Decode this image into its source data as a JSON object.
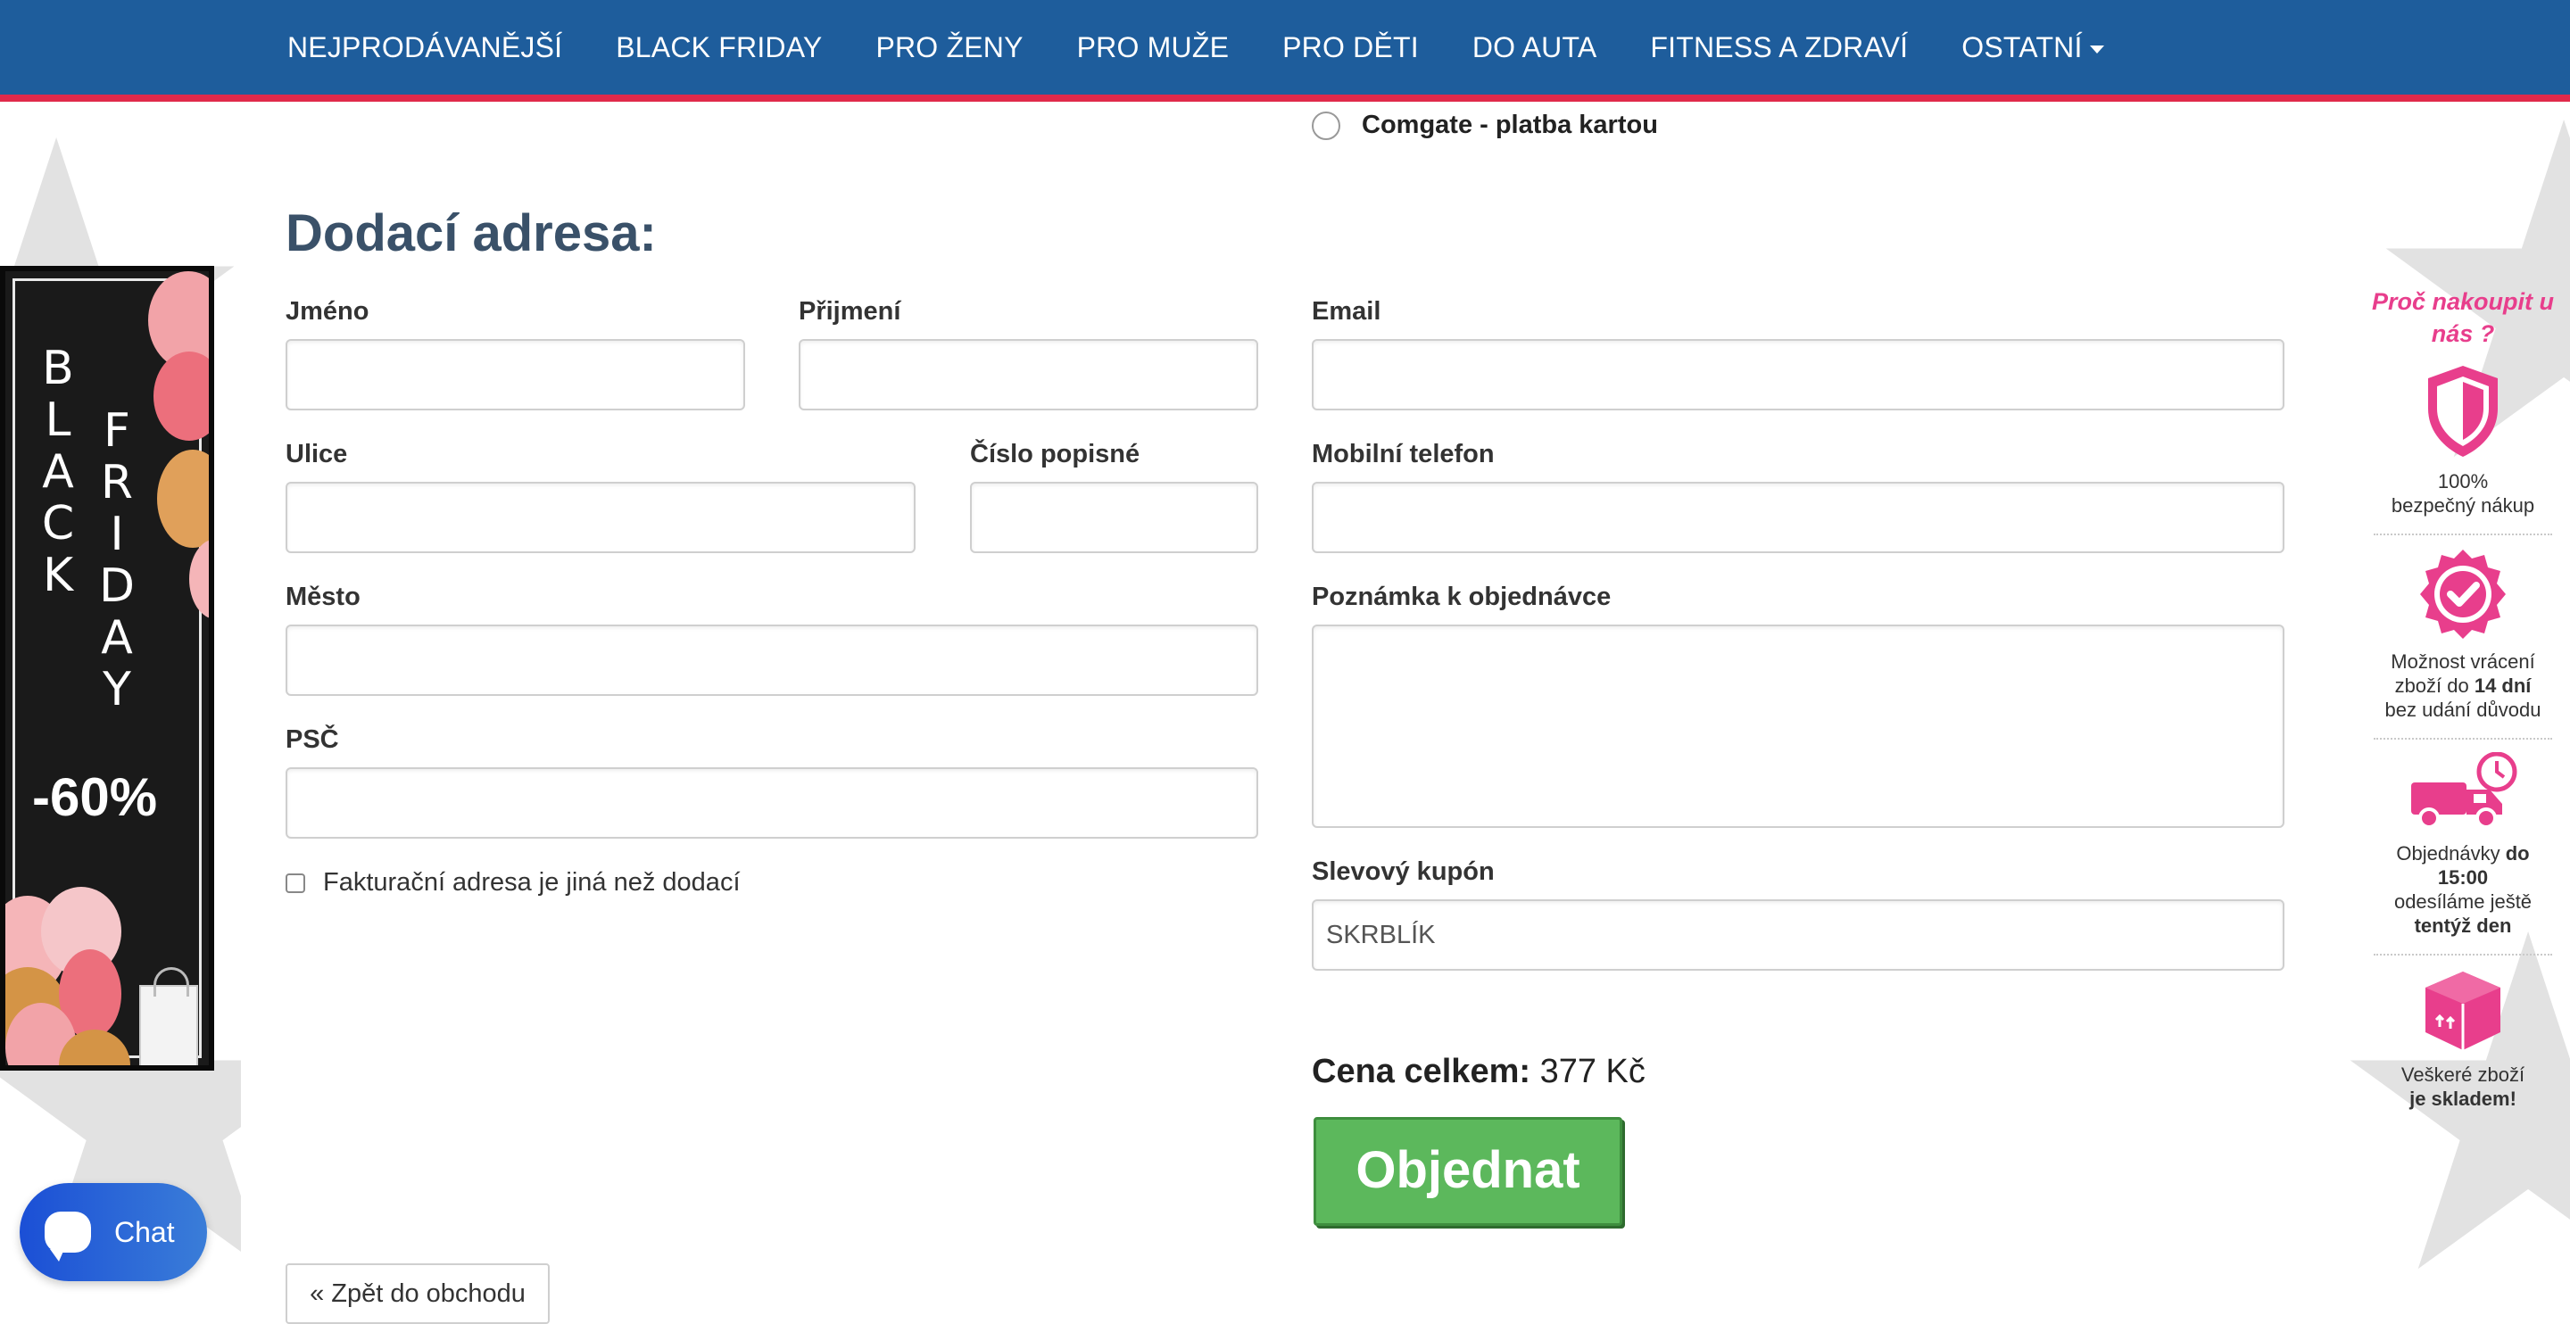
{
  "nav": {
    "items": [
      {
        "label": "NEJPRODÁVANĚJŠÍ"
      },
      {
        "label": "BLACK FRIDAY"
      },
      {
        "label": "PRO ŽENY"
      },
      {
        "label": "PRO MUŽE"
      },
      {
        "label": "PRO DĚTI"
      },
      {
        "label": "DO AUTA"
      },
      {
        "label": "FITNESS A ZDRAVÍ"
      },
      {
        "label": "OSTATNÍ"
      }
    ]
  },
  "payment": {
    "option_label": "Comgate - platba kartou"
  },
  "form": {
    "title": "Dodací adresa:",
    "first_name": {
      "label": "Jméno",
      "value": ""
    },
    "last_name": {
      "label": "Přijmení",
      "value": ""
    },
    "email": {
      "label": "Email",
      "value": ""
    },
    "street": {
      "label": "Ulice",
      "value": ""
    },
    "house_number": {
      "label": "Číslo popisné",
      "value": ""
    },
    "phone": {
      "label": "Mobilní telefon",
      "value": ""
    },
    "city": {
      "label": "Město",
      "value": ""
    },
    "note": {
      "label": "Poznámka k objednávce",
      "value": ""
    },
    "zip": {
      "label": "PSČ",
      "value": ""
    },
    "billing_checkbox_label": "Fakturační adresa je jiná než dodací",
    "coupon": {
      "label": "Slevový kupón",
      "value": "SKRBLÍK"
    }
  },
  "summary": {
    "total_label": "Cena celkem:",
    "total_value": "377 Kč",
    "order_button": "Objednat",
    "back_button": "« Zpět do obchodu"
  },
  "banner": {
    "word1": [
      "B",
      "L",
      "A",
      "C",
      "K"
    ],
    "word2": [
      "F",
      "R",
      "I",
      "D",
      "A",
      "Y"
    ],
    "discount": "-60%"
  },
  "why": {
    "title": "Proč nakoupit u nás ?",
    "items": [
      {
        "icon": "shield-icon",
        "line1": "100%",
        "line2": "bezpečný nákup"
      },
      {
        "icon": "badge-check-icon",
        "line1": "Možnost vrácení",
        "line2a": "zboží do ",
        "line2b": "14 dní",
        "line3": "bez udání důvodu"
      },
      {
        "icon": "truck-clock-icon",
        "line1a": "Objednávky ",
        "line1b": "do 15:00",
        "line2": "odesíláme ještě",
        "line3": "tentýž den"
      },
      {
        "icon": "box-icon",
        "line1": "Veškeré zboží",
        "line2": "je skladem!"
      }
    ]
  },
  "chat": {
    "label": "Chat"
  },
  "colors": {
    "nav_bg": "#1e5d9c",
    "nav_border": "#e0294a",
    "accent_pink": "#e83e8c",
    "order_green": "#5cb85c",
    "title_color": "#3a5169"
  }
}
